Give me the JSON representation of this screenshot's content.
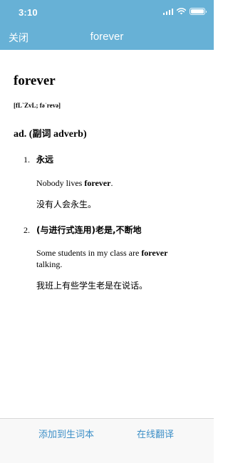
{
  "status_bar": {
    "time": "3:10",
    "icons": [
      "signal-icon",
      "wifi-icon",
      "battery-icon"
    ]
  },
  "nav": {
    "close_label": "关闭",
    "title": "forever"
  },
  "entry": {
    "word": "forever",
    "phonetic": "[fL`ZvL; fəˈrevə]",
    "pos": "ad. (",
    "pos_cn": "副词",
    "pos_en": " adverb)",
    "senses": [
      {
        "number": "1.",
        "definition": "永远",
        "example_pre": "Nobody lives ",
        "example_bold": "forever",
        "example_post": ".",
        "translation": "没有人会永生。"
      },
      {
        "number": "2.",
        "definition": "(与进行式连用)老是,不断地",
        "example_pre": "Some students in my class are ",
        "example_bold": "forever",
        "example_post": " talking.",
        "translation": "我班上有些学生老是在说话。"
      }
    ]
  },
  "bottom_bar": {
    "add_label": "添加到生词本",
    "translate_label": "在线翻译"
  },
  "colors": {
    "header_bg": "#67b1d6",
    "accent": "#3d8fc7",
    "bottom_bg": "#f8f8f8"
  }
}
